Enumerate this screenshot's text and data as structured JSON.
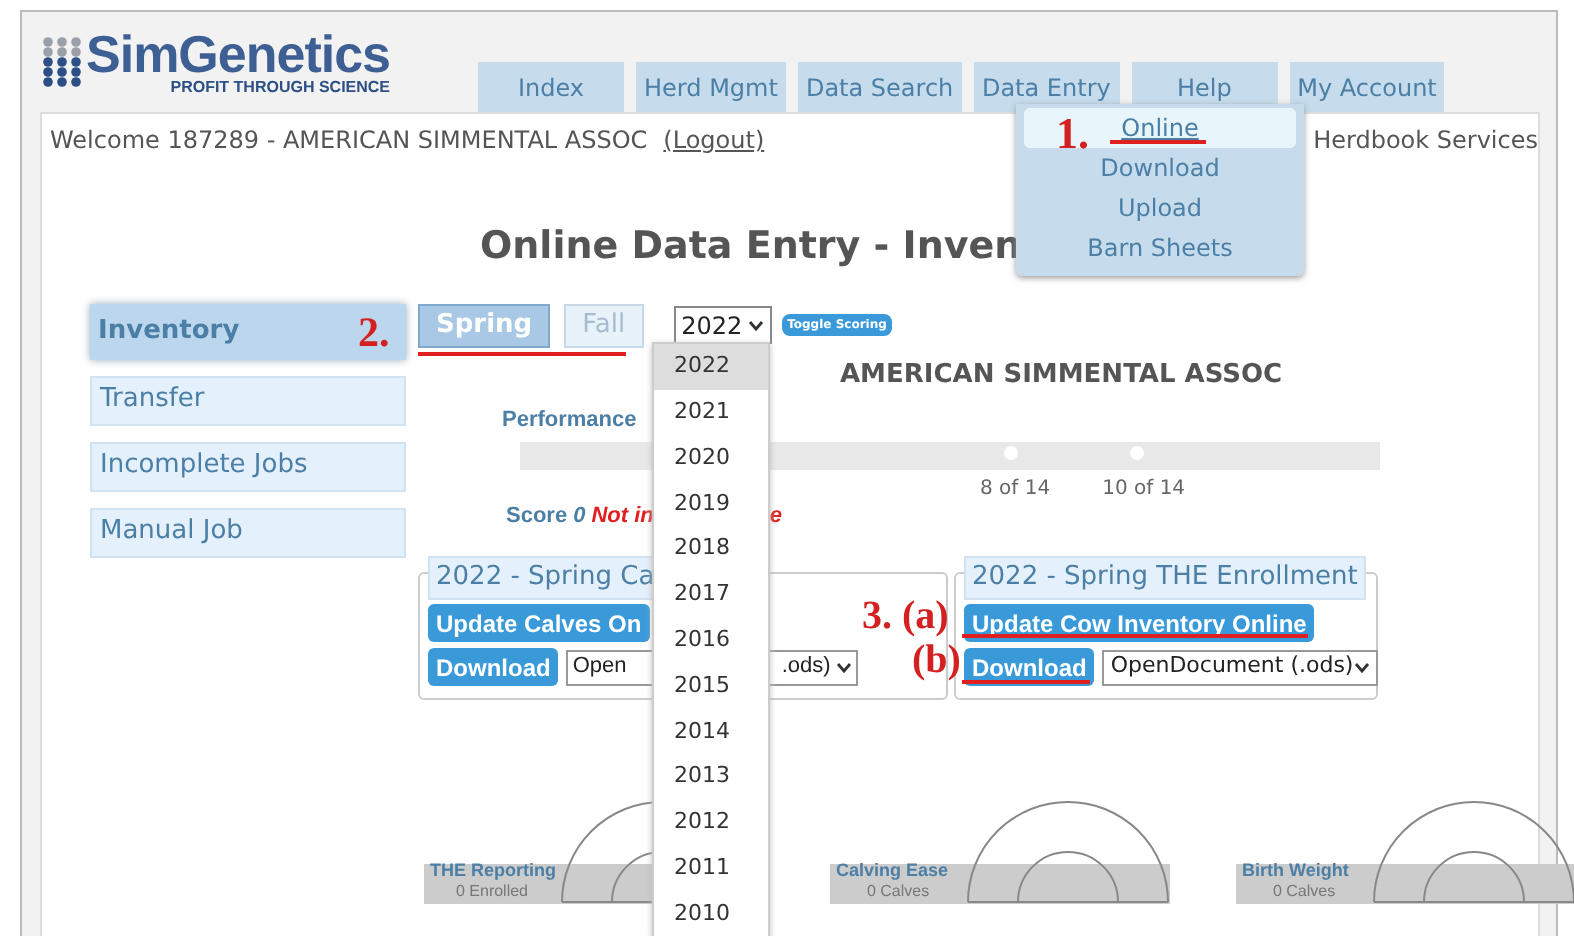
{
  "logo": {
    "name": "SimGenetics",
    "tagline": "PROFIT THROUGH SCIENCE"
  },
  "nav_tabs": [
    {
      "label": "Index"
    },
    {
      "label": "Herd Mgmt"
    },
    {
      "label": "Data Search"
    },
    {
      "label": "Data Entry"
    },
    {
      "label": "Help"
    },
    {
      "label": "My Account"
    }
  ],
  "data_entry_menu": [
    {
      "label": "Online",
      "selected": true
    },
    {
      "label": "Download",
      "selected": false
    },
    {
      "label": "Upload",
      "selected": false
    },
    {
      "label": "Barn Sheets",
      "selected": false
    }
  ],
  "welcome": "Welcome 187289 - AMERICAN SIMMENTAL ASSOC",
  "logout_link": "(Logout)",
  "herdbook_link": "Herdbook Services",
  "page_title": "Online Data Entry - Inven",
  "sidebar": [
    {
      "label": "Inventory",
      "selected": true
    },
    {
      "label": "Transfer",
      "selected": false
    },
    {
      "label": "Incomplete Jobs",
      "selected": false
    },
    {
      "label": "Manual Job",
      "selected": false
    }
  ],
  "season_tabs": [
    {
      "label": "Spring",
      "selected": true
    },
    {
      "label": "Fall",
      "selected": false
    }
  ],
  "year_select": {
    "value": "2022",
    "options": [
      {
        "label": "2022",
        "selected": true
      },
      {
        "label": "2021",
        "selected": false
      },
      {
        "label": "2020",
        "selected": false
      },
      {
        "label": "2019",
        "selected": false
      },
      {
        "label": "2018",
        "selected": false
      },
      {
        "label": "2017",
        "selected": false
      },
      {
        "label": "2016",
        "selected": false
      },
      {
        "label": "2015",
        "selected": false
      },
      {
        "label": "2014",
        "selected": false
      },
      {
        "label": "2013",
        "selected": false
      },
      {
        "label": "2012",
        "selected": false
      },
      {
        "label": "2011",
        "selected": false
      },
      {
        "label": "2010",
        "selected": false
      }
    ]
  },
  "toggle_button": "Toggle Scoring",
  "herd_name": "AMERICAN SIMMENTAL ASSOC",
  "performance": {
    "label": "Performance",
    "marker_labels": [
      "8 of 14",
      "10 of 14"
    ]
  },
  "score": {
    "label": "Score",
    "value": "0",
    "status": "Not in",
    "status_tail": "e"
  },
  "panels": [
    {
      "legend": "2022 - Spring Ca",
      "primary_button": "Update Calves On",
      "download_button": "Download",
      "format_head": "Open",
      "format_tail": ".ods)"
    },
    {
      "legend": "2022 - Spring THE Enrollment",
      "primary_button": "Update Cow Inventory Online",
      "download_button": "Download",
      "format_value": "OpenDocument (.ods)"
    }
  ],
  "gauges": [
    {
      "title": "THE Reporting",
      "count": "0 Enrolled"
    },
    {
      "title": "Calving Ease",
      "count": "0 Calves"
    },
    {
      "title": "Birth Weight",
      "count": "0 Calves"
    }
  ],
  "annotations": [
    {
      "text": "1."
    },
    {
      "text": "2."
    },
    {
      "text": "3. (a)"
    },
    {
      "text": "(b)"
    }
  ]
}
